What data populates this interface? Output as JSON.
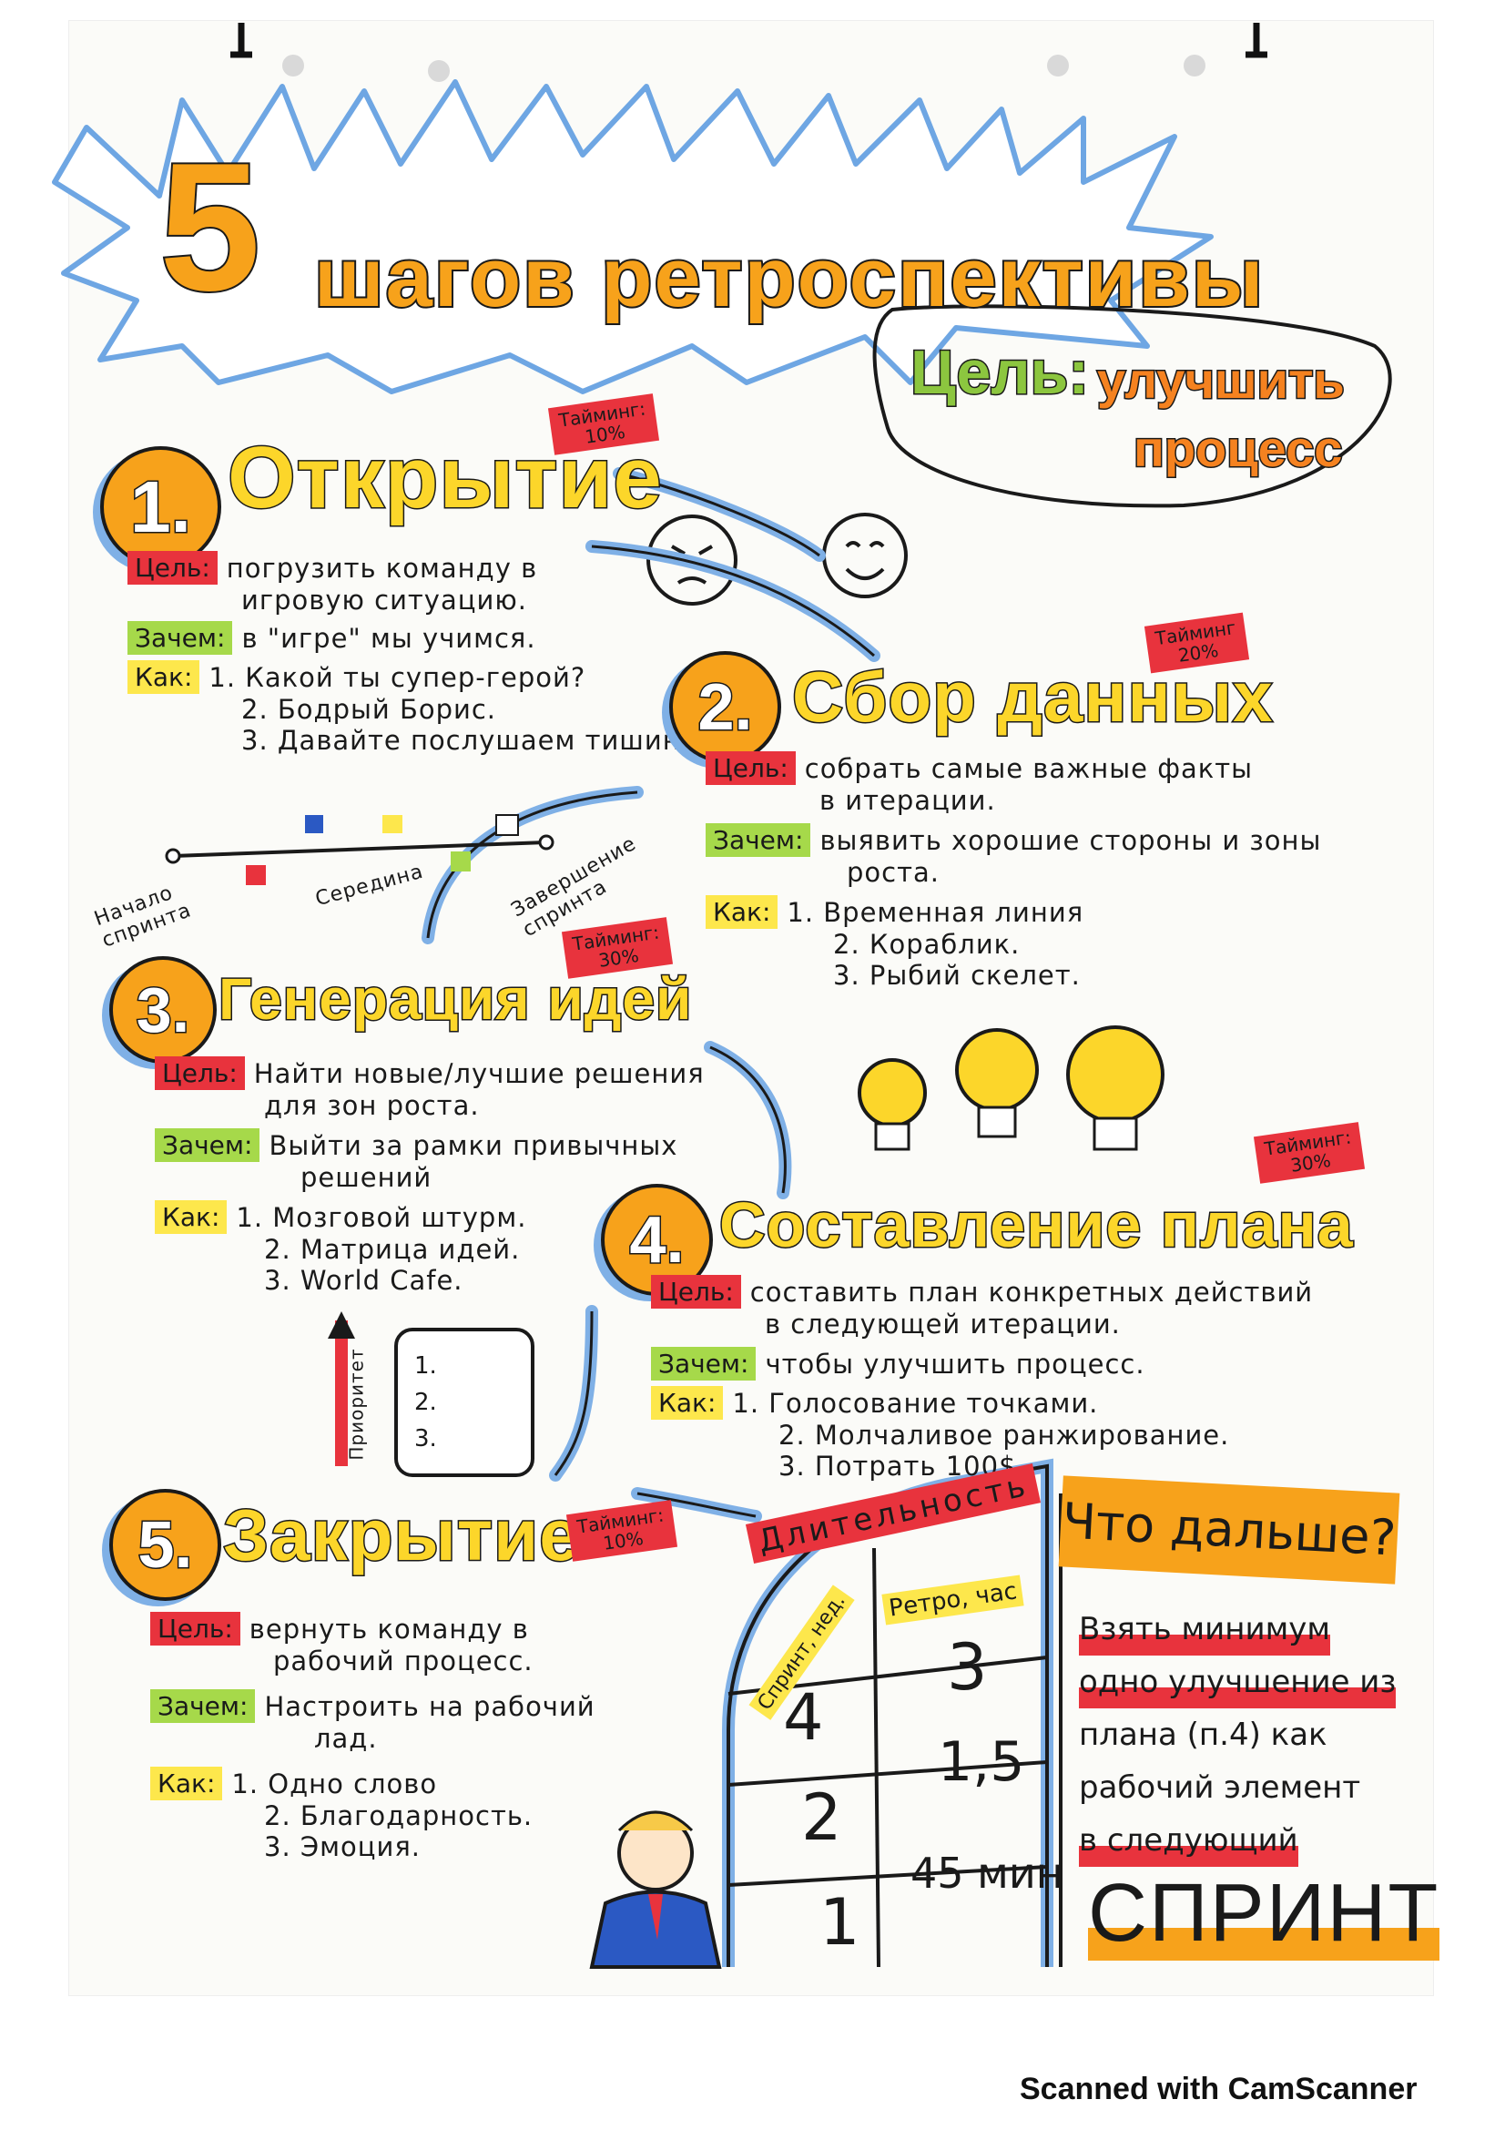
{
  "title": {
    "number": "5",
    "text": "шагов ретроспективы"
  },
  "goal": {
    "label": "Цель:",
    "text_line1": "улучшить",
    "text_line2": "процесс"
  },
  "labels": {
    "goal": "Цель:",
    "why": "Зачем:",
    "how": "Как:"
  },
  "steps": [
    {
      "number": "1.",
      "title": "Открытие",
      "timing_label": "Тайминг:",
      "timing_value": "10%",
      "goal_lines": [
        "погрузить команду в",
        "игровую ситуацию."
      ],
      "why_lines": [
        "в \"игре\" мы учимся."
      ],
      "how": [
        "1. Какой ты супер-герой?",
        "2. Бодрый Борис.",
        "3. Давайте послушаем тишину"
      ]
    },
    {
      "number": "2.",
      "title": "Сбор данных",
      "timing_label": "Тайминг",
      "timing_value": "20%",
      "goal_lines": [
        "собрать самые важные факты",
        "в итерации."
      ],
      "why_lines": [
        "выявить хорошие стороны и зоны",
        "роста."
      ],
      "how": [
        "1. Временная линия",
        "2. Кораблик.",
        "3. Рыбий скелет."
      ]
    },
    {
      "number": "3.",
      "title": "Генерация идей",
      "timing_label": "Тайминг:",
      "timing_value": "30%",
      "goal_lines": [
        "Найти новые/лучшие решения",
        "для зон роста."
      ],
      "why_lines": [
        "Выйти за рамки привычных",
        "решений"
      ],
      "how": [
        "1. Мозговой штурм.",
        "2. Матрица идей.",
        "3. World Cafe."
      ]
    },
    {
      "number": "4.",
      "title": "Составление плана",
      "timing_label": "Тайминг:",
      "timing_value": "30%",
      "goal_lines": [
        "составить план конкретных действий",
        "в следующей итерации."
      ],
      "why_lines": [
        "чтобы улучшить процесс."
      ],
      "how": [
        "1. Голосование точками.",
        "2. Молчаливое ранжирование.",
        "3. Потрать 100$."
      ]
    },
    {
      "number": "5.",
      "title": "Закрытие",
      "timing_label": "Тайминг:",
      "timing_value": "10%",
      "goal_lines": [
        "вернуть команду в",
        "рабочий процесс."
      ],
      "why_lines": [
        "Настроить на рабочий",
        "лад."
      ],
      "how": [
        "1. Одно слово",
        "2. Благодарность.",
        "3. Эмоция."
      ]
    }
  ],
  "timeline": {
    "start": "Начало спринта",
    "middle": "Середина",
    "end": "Завершение спринта"
  },
  "priority_list": {
    "label": "Приоритет",
    "items": [
      "1.",
      "2.",
      "3."
    ]
  },
  "duration_table": {
    "title": "Длительность",
    "col1": "Спринт, нед.",
    "col2": "Ретро, час",
    "rows": [
      {
        "sprint": "4",
        "retro": "3"
      },
      {
        "sprint": "2",
        "retro": "1,5"
      },
      {
        "sprint": "1",
        "retro": "45 мин"
      }
    ]
  },
  "whats_next": {
    "title": "Что дальше?",
    "lines": [
      "Взять минимум",
      "одно улучшение из",
      "плана (п.4) как",
      "рабочий элемент",
      "в следующий"
    ],
    "big": "СПРИНТ"
  },
  "footer": {
    "scanner": "Scanned with CamScanner"
  },
  "colors": {
    "orange": "#f7a21b",
    "yellow": "#fcd62a",
    "red": "#e8333d",
    "green": "#a6d94a",
    "blue": "#7fb0e6"
  }
}
